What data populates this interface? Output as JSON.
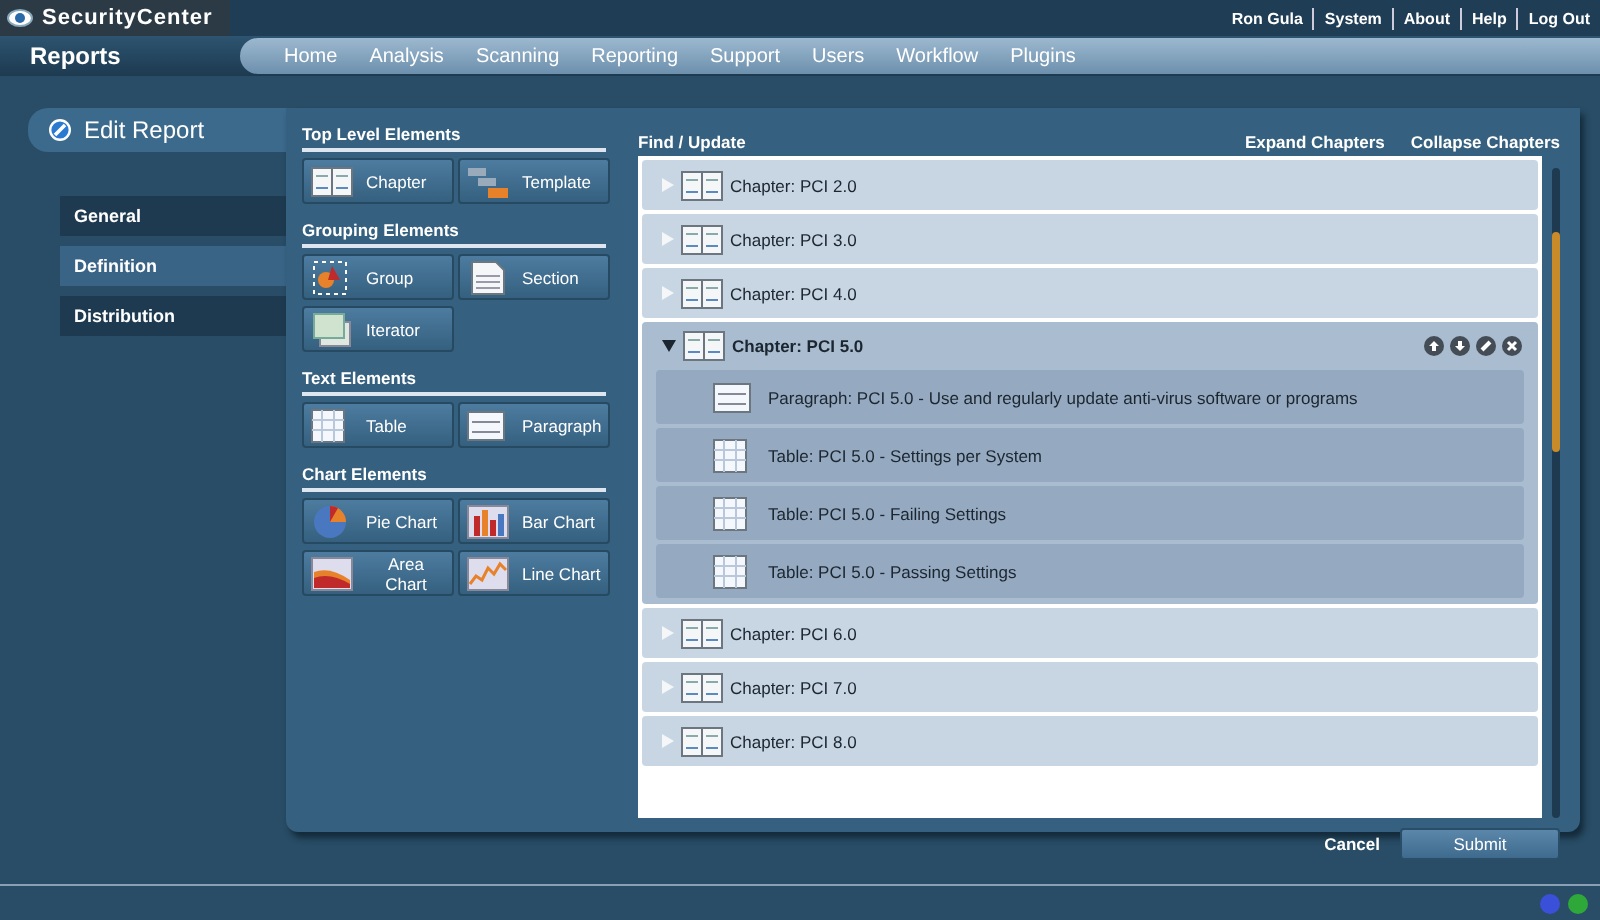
{
  "app": {
    "logo_text": "SecurityCenter",
    "user_links": [
      "Ron Gula",
      "System",
      "About",
      "Help",
      "Log Out"
    ]
  },
  "nav": {
    "section": "Reports",
    "items": [
      {
        "label": "Home"
      },
      {
        "label": "Analysis"
      },
      {
        "label": "Scanning"
      },
      {
        "label": "Reporting"
      },
      {
        "label": "Support"
      },
      {
        "label": "Users"
      },
      {
        "label": "Workflow"
      },
      {
        "label": "Plugins"
      }
    ]
  },
  "page": {
    "title": "Edit Report"
  },
  "side_tabs": [
    {
      "label": "General",
      "selected": false
    },
    {
      "label": "Definition",
      "selected": true
    },
    {
      "label": "Distribution",
      "selected": false
    }
  ],
  "palette": [
    {
      "title": "Top Level Elements",
      "items": [
        {
          "label": "Chapter",
          "kind": "chapter"
        },
        {
          "label": "Template",
          "kind": "template"
        }
      ]
    },
    {
      "title": "Grouping Elements",
      "items": [
        {
          "label": "Group",
          "kind": "group"
        },
        {
          "label": "Section",
          "kind": "section"
        },
        {
          "label": "Iterator",
          "kind": "iterator"
        }
      ]
    },
    {
      "title": "Text Elements",
      "items": [
        {
          "label": "Table",
          "kind": "table"
        },
        {
          "label": "Paragraph",
          "kind": "paragraph"
        }
      ]
    },
    {
      "title": "Chart Elements",
      "items": [
        {
          "label": "Pie Chart",
          "kind": "pie"
        },
        {
          "label": "Bar Chart",
          "kind": "bar"
        },
        {
          "label": "Area Chart",
          "kind": "area"
        },
        {
          "label": "Line Chart",
          "kind": "line"
        }
      ]
    }
  ],
  "toolbar": {
    "find": "Find / Update",
    "expand": "Expand Chapters",
    "collapse": "Collapse Chapters"
  },
  "chapters": [
    {
      "title": "Chapter: PCI 2.0",
      "expanded": false
    },
    {
      "title": "Chapter: PCI 3.0",
      "expanded": false
    },
    {
      "title": "Chapter: PCI 4.0",
      "expanded": false
    },
    {
      "title": "Chapter: PCI 5.0",
      "expanded": true,
      "children": [
        {
          "kind": "paragraph",
          "title": "Paragraph: PCI 5.0 - Use and regularly update anti-virus software or programs"
        },
        {
          "kind": "table",
          "title": "Table: PCI 5.0 - Settings per System"
        },
        {
          "kind": "table",
          "title": "Table: PCI 5.0 - Failing Settings"
        },
        {
          "kind": "table",
          "title": "Table: PCI 5.0 - Passing Settings"
        }
      ]
    },
    {
      "title": "Chapter: PCI 6.0",
      "expanded": false
    },
    {
      "title": "Chapter: PCI 7.0",
      "expanded": false
    },
    {
      "title": "Chapter: PCI 8.0",
      "expanded": false
    }
  ],
  "footer": {
    "cancel": "Cancel",
    "submit": "Submit"
  },
  "status_lights": [
    {
      "color": "#3a50d8"
    },
    {
      "color": "#2fa83a"
    }
  ]
}
